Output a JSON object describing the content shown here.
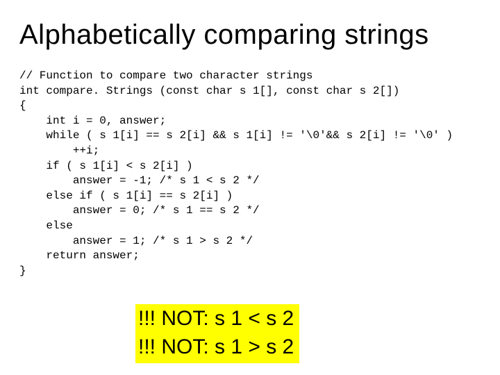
{
  "title": "Alphabetically comparing strings",
  "code": {
    "l00": "// Function to compare two character strings",
    "l01": "int compare. Strings (const char s 1[], const char s 2[])",
    "l02": "{",
    "l03": "    int i = 0, answer;",
    "l04": "    while ( s 1[i] == s 2[i] && s 1[i] != '\\0'&& s 2[i] != '\\0' )",
    "l05": "        ++i;",
    "l06": "    if ( s 1[i] < s 2[i] )",
    "l07": "        answer = -1; /* s 1 < s 2 */",
    "l08": "    else if ( s 1[i] == s 2[i] )",
    "l09": "        answer = 0; /* s 1 == s 2 */",
    "l10": "    else",
    "l11": "        answer = 1; /* s 1 > s 2 */",
    "l12": "    return answer;",
    "l13": "}"
  },
  "callout": {
    "line1": "!!!  NOT:  s 1 <  s 2",
    "line2": "!!!  NOT:  s 1  > s 2"
  }
}
